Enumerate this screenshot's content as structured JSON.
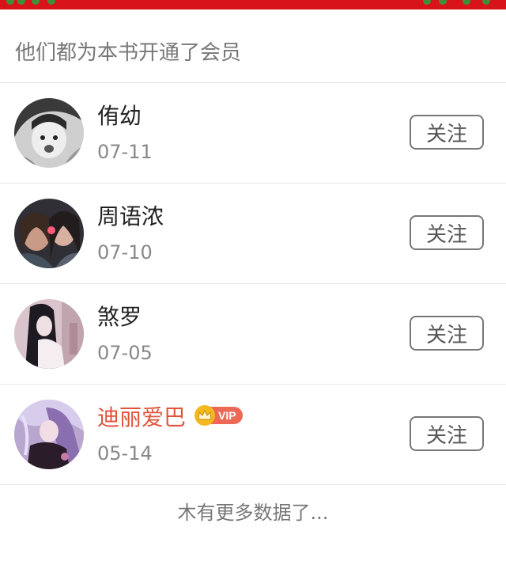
{
  "header": {
    "title": "他们都为本书开通了会员"
  },
  "members": [
    {
      "name": "侑幼",
      "date": "07-11",
      "follow_label": "关注",
      "vip": false,
      "name_color": "#222222"
    },
    {
      "name": "周语浓",
      "date": "07-10",
      "follow_label": "关注",
      "vip": false,
      "name_color": "#222222"
    },
    {
      "name": "煞罗",
      "date": "07-05",
      "follow_label": "关注",
      "vip": false,
      "name_color": "#222222"
    },
    {
      "name": "迪丽爱巴",
      "date": "05-14",
      "follow_label": "关注",
      "vip": true,
      "vip_label": "VIP",
      "name_color": "#e0543a"
    }
  ],
  "footer": {
    "text": "木有更多数据了..."
  },
  "colors": {
    "banner": "#d8141a",
    "vip_badge": "#ec6a55",
    "crown": "#f4b91f",
    "divider": "#e6e6e6"
  }
}
